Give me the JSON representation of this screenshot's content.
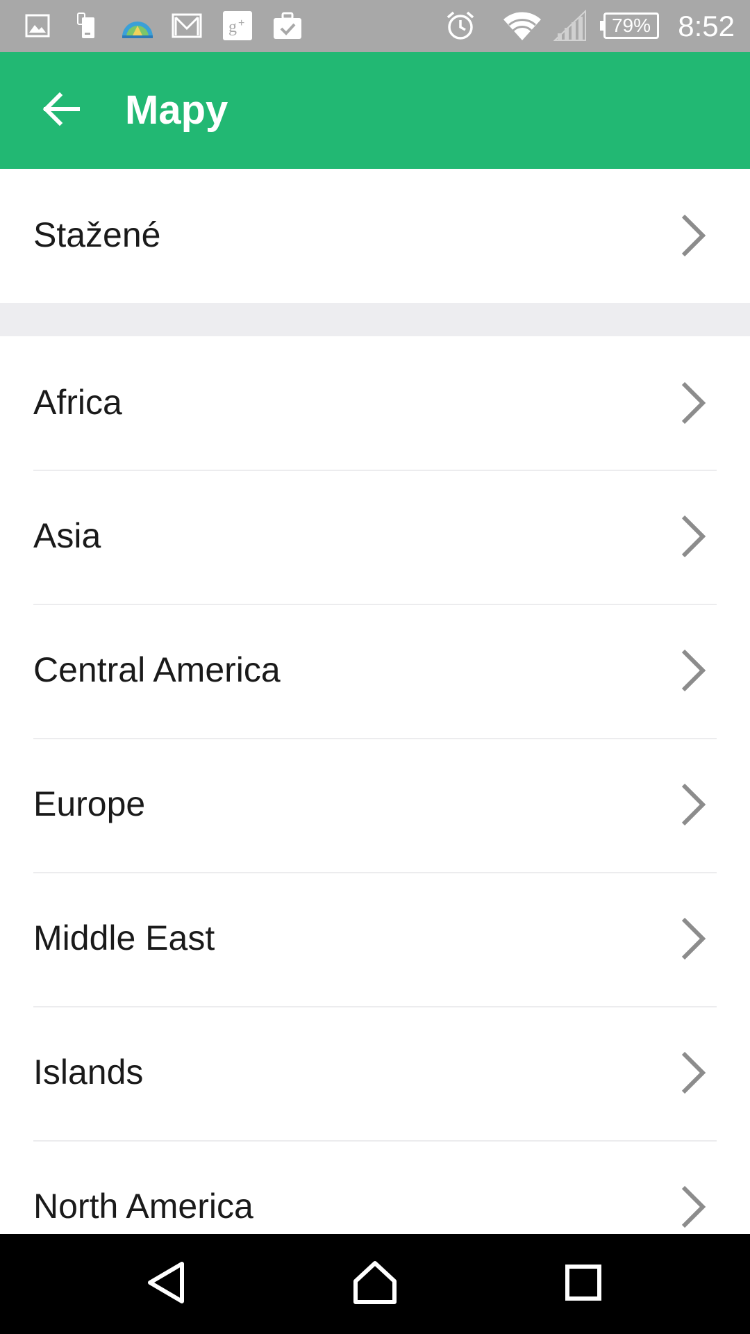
{
  "status_bar": {
    "time": "8:52",
    "battery": "79%",
    "left_icons": [
      "image-icon",
      "phone-transfer-icon",
      "maps-app-icon",
      "gmail-icon",
      "google-plus-icon",
      "briefcase-check-icon"
    ],
    "right_icons": [
      "alarm-icon",
      "wifi-icon",
      "cellular-signal-icon",
      "battery-icon"
    ]
  },
  "app_bar": {
    "title": "Mapy",
    "back_icon": "arrow-left-icon",
    "color": "#22b873"
  },
  "downloaded": {
    "label": "Stažené"
  },
  "regions": [
    {
      "label": "Africa"
    },
    {
      "label": "Asia"
    },
    {
      "label": "Central America"
    },
    {
      "label": "Europe"
    },
    {
      "label": "Middle East"
    },
    {
      "label": "Islands"
    },
    {
      "label": "North America"
    }
  ],
  "nav_bar": {
    "back_icon": "nav-back-icon",
    "home_icon": "nav-home-icon",
    "recents_icon": "nav-recents-icon"
  }
}
